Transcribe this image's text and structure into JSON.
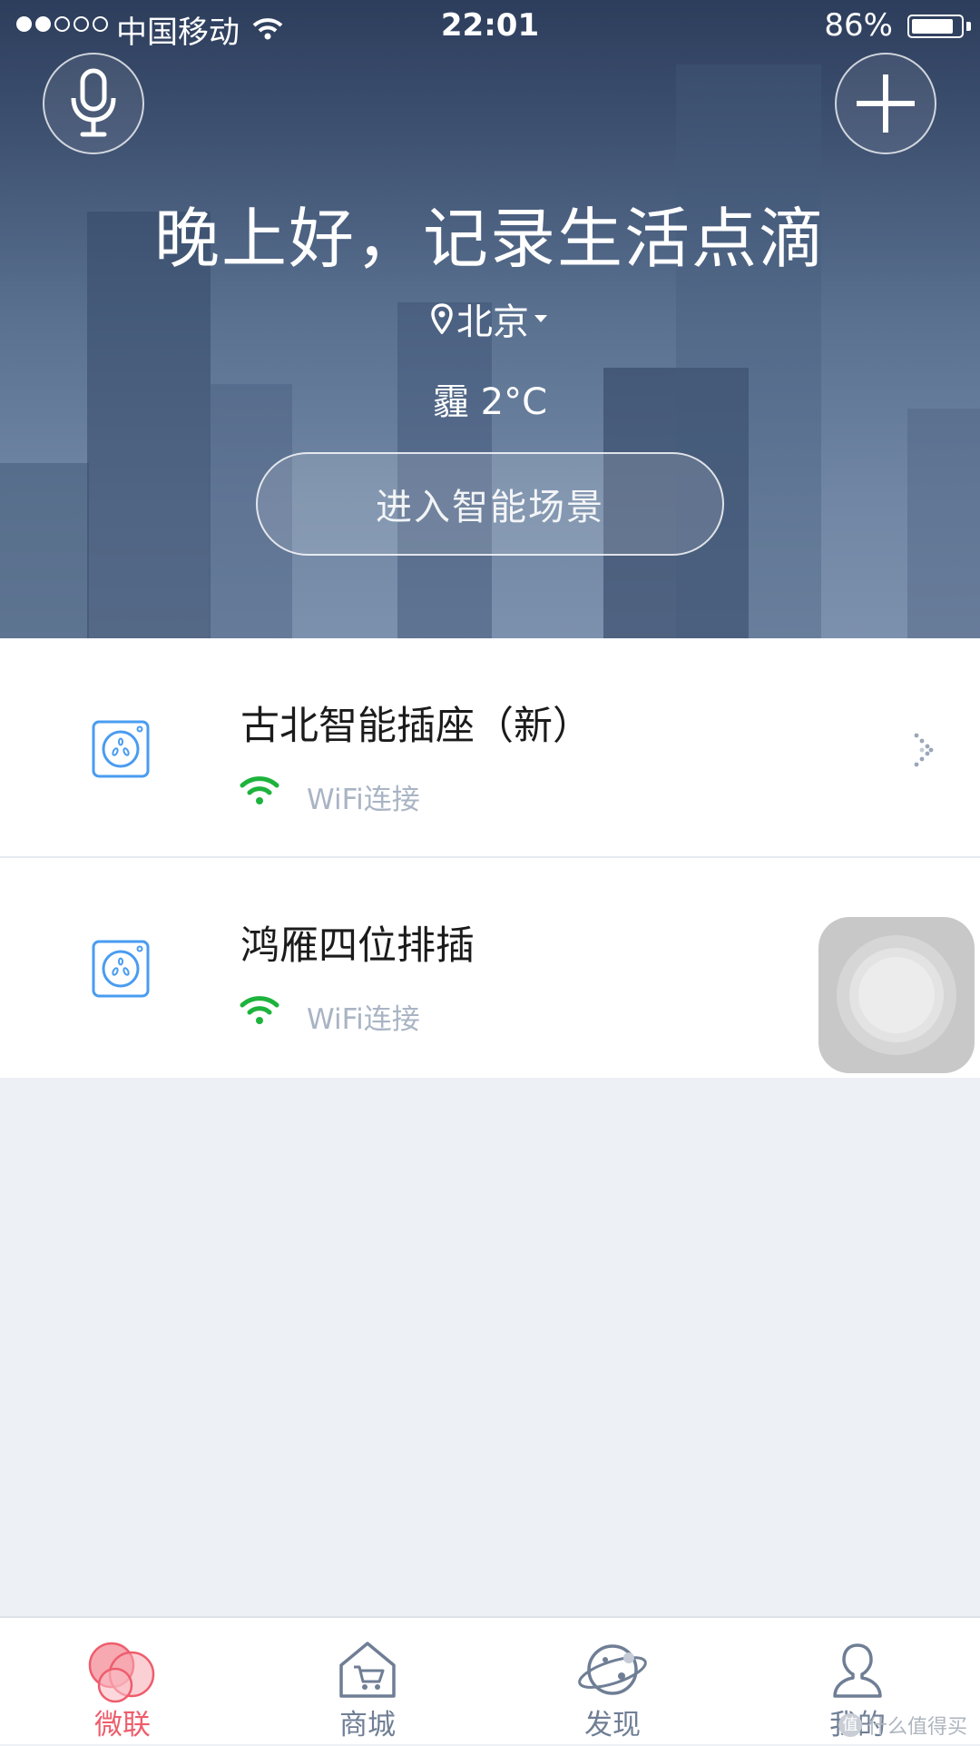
{
  "status_bar": {
    "signal_filled": 2,
    "signal_total": 5,
    "carrier": "中国移动",
    "time": "22:01",
    "battery_percent": "86%",
    "battery_level": 0.86
  },
  "header": {
    "voice_icon": "microphone-icon",
    "add_icon": "plus-icon",
    "greeting": "晚上好，记录生活点滴",
    "city": "北京",
    "weather": "霾 2°C",
    "scene_button": "进入智能场景"
  },
  "devices": [
    {
      "name": "古北智能插座（新）",
      "status": "WiFi连接",
      "icon": "smart-socket-icon"
    },
    {
      "name": "鸿雁四位排插",
      "status": "WiFi连接",
      "icon": "smart-socket-icon"
    }
  ],
  "tabs": [
    {
      "label": "微联",
      "icon": "bubbles-icon",
      "active": true
    },
    {
      "label": "商城",
      "icon": "shop-cart-icon",
      "active": false
    },
    {
      "label": "发现",
      "icon": "planet-icon",
      "active": false
    },
    {
      "label": "我的",
      "icon": "user-icon",
      "active": false
    }
  ],
  "watermark": "什么值得买",
  "colors": {
    "accent": "#ee5d6c",
    "wifi_green": "#1db33c",
    "device_icon_blue": "#4a9cf0",
    "tab_inactive": "#6f7e95"
  }
}
